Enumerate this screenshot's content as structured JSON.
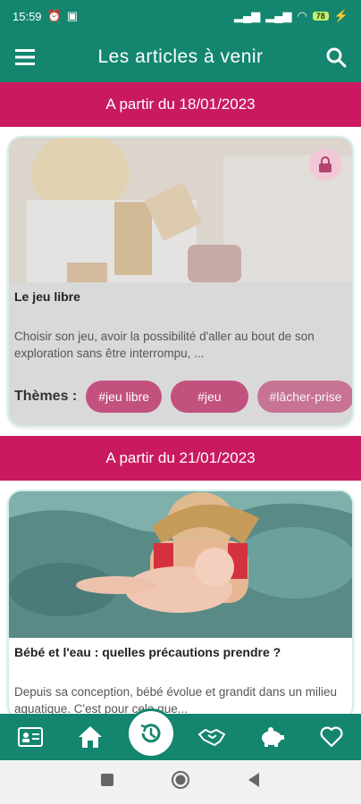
{
  "status_bar": {
    "time": "15:59",
    "battery": "78"
  },
  "app_bar": {
    "title": "Les articles à venir"
  },
  "sections": [
    {
      "header": "A partir du 18/01/2023",
      "card": {
        "title": "Le jeu libre",
        "excerpt": "Choisir son jeu, avoir la possibilité d'aller au bout de son exploration sans être interrompu, ...",
        "themes_label": "Thèmes :",
        "themes": [
          "#jeu libre",
          "#jeu",
          "#lâcher-prise"
        ]
      }
    },
    {
      "header": "A partir du 21/01/2023",
      "card": {
        "title": "Bébé et l'eau : quelles précautions prendre ?",
        "excerpt": "Depuis sa conception, bébé évolue et grandit dans un milieu aquatique. C'est pour cela que..."
      }
    }
  ],
  "colors": {
    "primary": "#14866f",
    "accent": "#c91a5f",
    "chip": "#c2517e"
  },
  "bottom_nav": [
    "id-card-icon",
    "home-icon",
    "history-icon",
    "handshake-icon",
    "piggy-bank-icon",
    "heart-icon"
  ]
}
